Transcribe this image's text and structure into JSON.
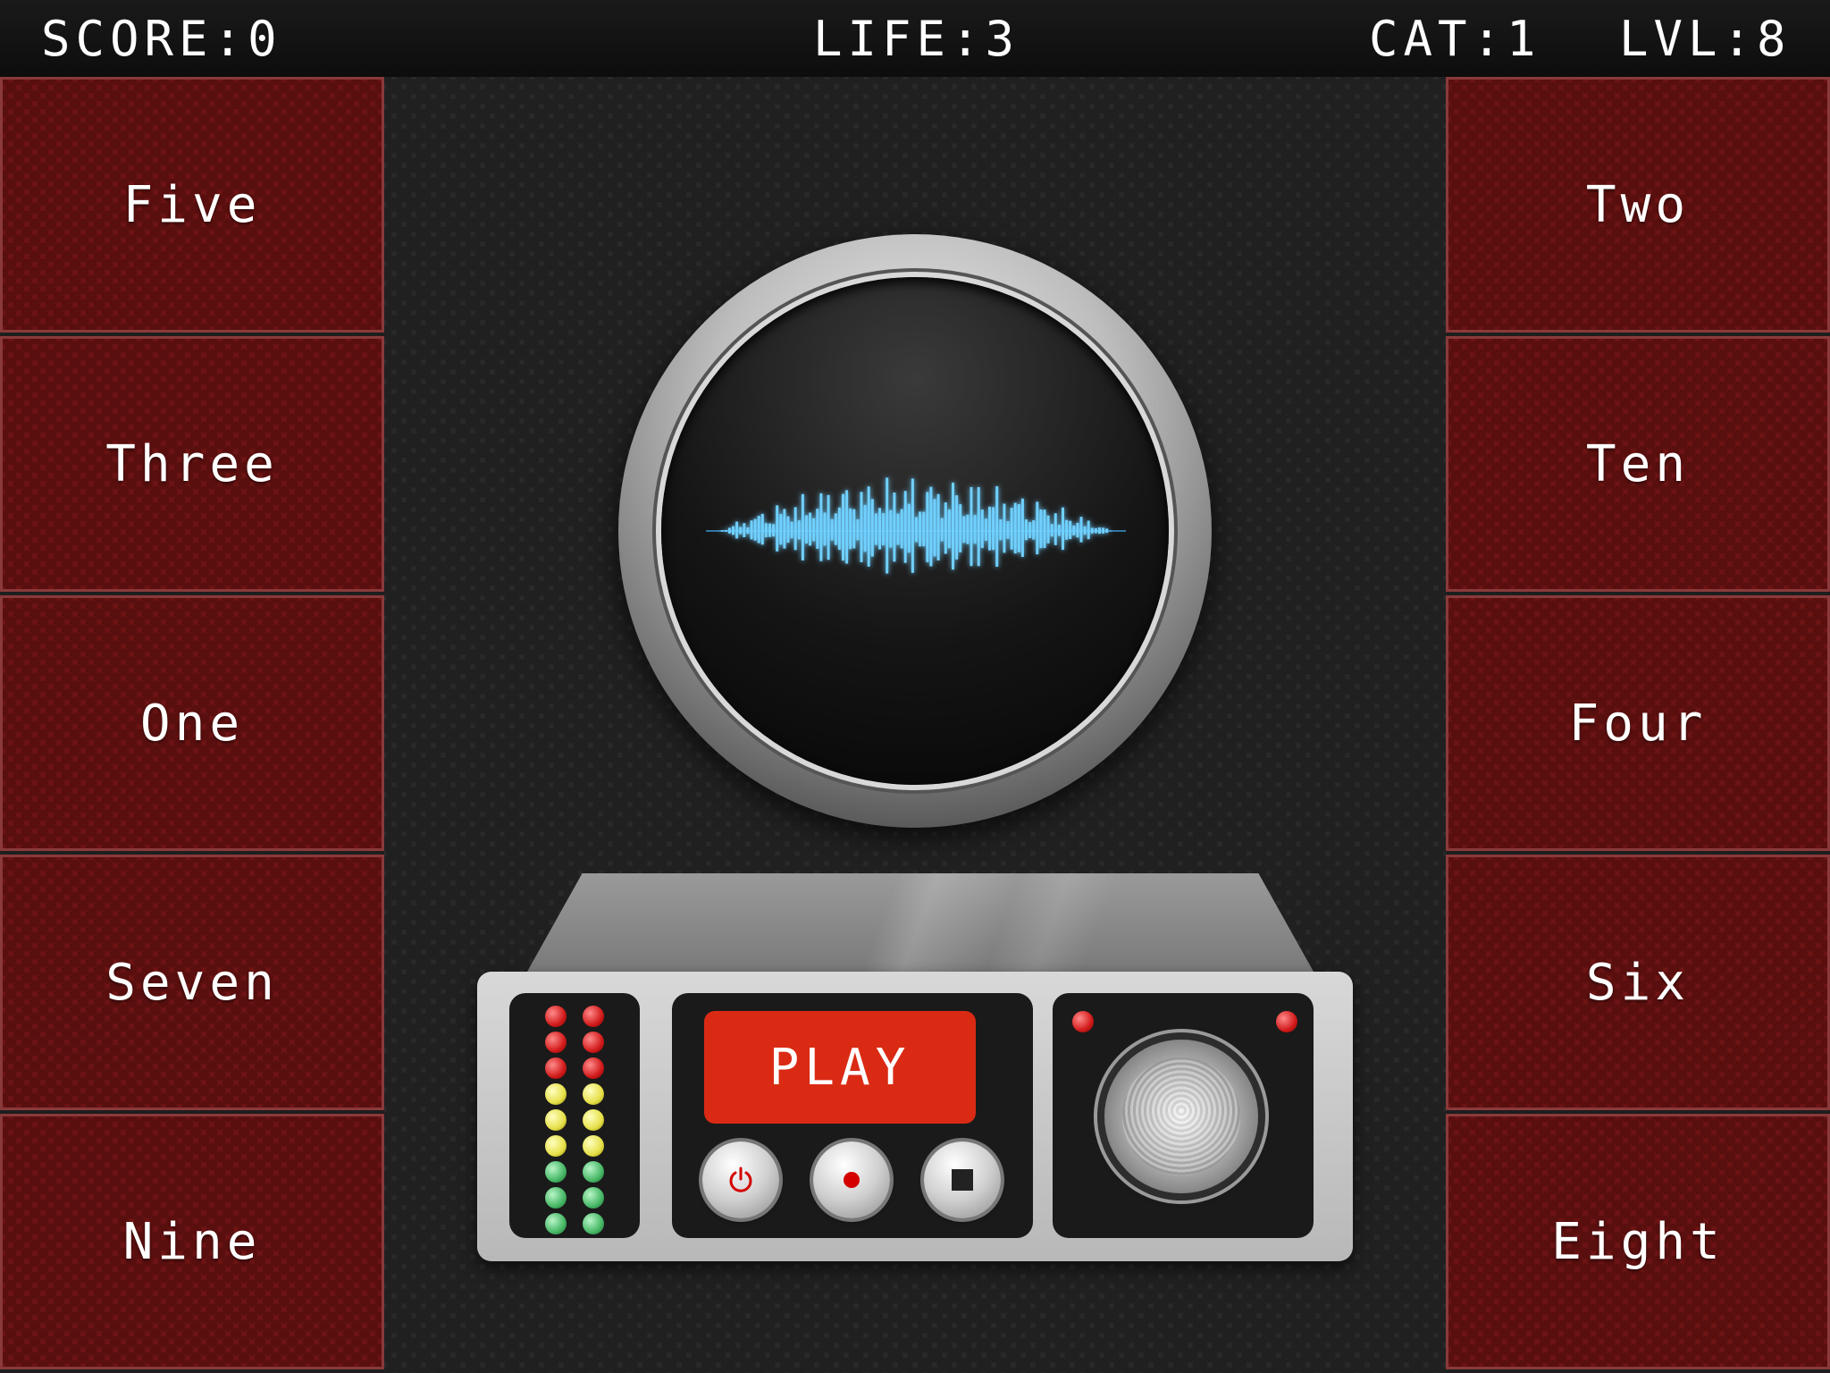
{
  "hud": {
    "score": "SCORE:0",
    "life": "LIFE:3",
    "category": "CAT:1",
    "level": "LVL:8"
  },
  "left_answers": [
    "Five",
    "Three",
    "One",
    "Seven",
    "Nine"
  ],
  "right_answers": [
    "Two",
    "Ten",
    "Four",
    "Six",
    "Eight"
  ],
  "device": {
    "play_label": "PLAY",
    "buttons": [
      "power-icon",
      "record-icon",
      "stop-icon"
    ]
  },
  "colors": {
    "tile": "#6e1414",
    "play": "#da2a14",
    "wave": "#41b8ff"
  }
}
